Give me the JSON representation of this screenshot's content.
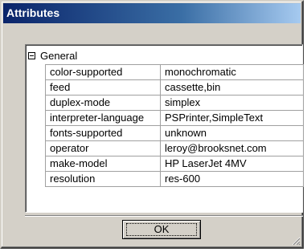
{
  "window": {
    "title": "Attributes"
  },
  "group": {
    "label": "General",
    "expander_icon": "minus-box-icon"
  },
  "attributes": [
    {
      "key": "color-supported",
      "value": "monochromatic"
    },
    {
      "key": "feed",
      "value": "cassette,bin"
    },
    {
      "key": "duplex-mode",
      "value": "simplex"
    },
    {
      "key": "interpreter-language",
      "value": "PSPrinter,SimpleText"
    },
    {
      "key": "fonts-supported",
      "value": "unknown"
    },
    {
      "key": "operator",
      "value": "leroy@brooksnet.com"
    },
    {
      "key": "make-model",
      "value": "HP LaserJet 4MV"
    },
    {
      "key": "resolution",
      "value": "res-600"
    }
  ],
  "buttons": {
    "ok_label": "OK"
  },
  "colors": {
    "titlebar_start": "#0a246a",
    "titlebar_end": "#a6caf0",
    "face": "#d4d0c8"
  }
}
